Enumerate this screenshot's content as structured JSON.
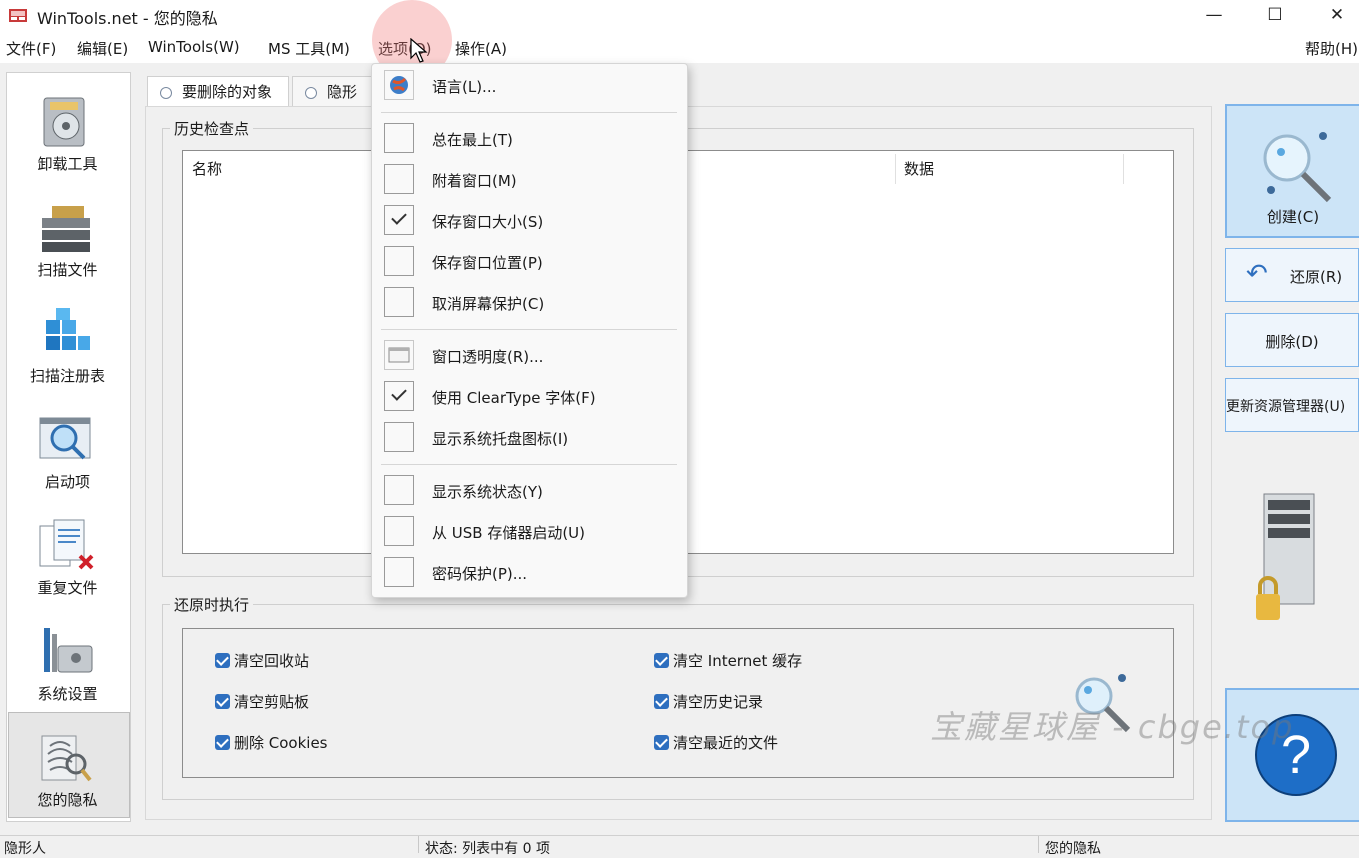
{
  "window": {
    "title": "WinTools.net - 您的隐私",
    "controls": {
      "minimize": "—",
      "maximize": "☐",
      "close": "✕"
    }
  },
  "menubar": {
    "items": [
      "文件(F)",
      "编辑(E)",
      "WinTools(W)",
      "MS 工具(M)",
      "选项(O)",
      "操作(A)"
    ],
    "help": "帮助(H)"
  },
  "sidebar": {
    "items": [
      {
        "label": "卸载工具",
        "icon": "uninstall-icon"
      },
      {
        "label": "扫描文件",
        "icon": "scan-files-icon"
      },
      {
        "label": "扫描注册表",
        "icon": "registry-icon"
      },
      {
        "label": "启动项",
        "icon": "startup-icon"
      },
      {
        "label": "重复文件",
        "icon": "duplicate-files-icon"
      },
      {
        "label": "系统设置",
        "icon": "system-settings-icon"
      },
      {
        "label": "您的隐私",
        "icon": "privacy-icon"
      }
    ]
  },
  "tabs": [
    {
      "label": "要删除的对象"
    },
    {
      "label": "隐形人"
    }
  ],
  "checkpoints": {
    "title": "历史检查点",
    "columns": {
      "name": "名称",
      "data": "数据"
    }
  },
  "restore": {
    "title": "还原时执行",
    "options": [
      {
        "label": "清空回收站",
        "checked": true
      },
      {
        "label": "清空剪贴板",
        "checked": true
      },
      {
        "label": "删除 Cookies",
        "checked": true
      },
      {
        "label": "清空 Internet 缓存",
        "checked": true
      },
      {
        "label": "清空历史记录",
        "checked": true
      },
      {
        "label": "清空最近的文件",
        "checked": true
      }
    ]
  },
  "actions": {
    "create": "创建(C)",
    "restore": "还原(R)",
    "delete": "删除(D)",
    "refresh_explorer": "更新资源管理器(U)",
    "help": "?"
  },
  "options_menu": {
    "items": [
      {
        "label": "语言(L)...",
        "type": "icon"
      },
      {
        "label": "总在最上(T)",
        "checked": false
      },
      {
        "label": "附着窗口(M)",
        "checked": false
      },
      {
        "label": "保存窗口大小(S)",
        "checked": true
      },
      {
        "label": "保存窗口位置(P)",
        "checked": false
      },
      {
        "label": "取消屏幕保护(C)",
        "checked": false
      },
      {
        "label": "窗口透明度(R)...",
        "type": "icon"
      },
      {
        "label": "使用 ClearType 字体(F)",
        "checked": true
      },
      {
        "label": "显示系统托盘图标(I)",
        "checked": false
      },
      {
        "label": "显示系统状态(Y)",
        "checked": false
      },
      {
        "label": "从 USB 存储器启动(U)",
        "checked": false
      },
      {
        "label": "密码保护(P)...",
        "checked": false
      }
    ]
  },
  "statusbar": {
    "left": "隐形人",
    "middle": "状态: 列表中有 0 项",
    "right": "您的隐私"
  },
  "watermark": "宝藏星球屋 - cbge.top",
  "colors": {
    "accent": "#2e6fbf",
    "button_blue": "#cce4f7",
    "button_border": "#7eb4ea"
  }
}
